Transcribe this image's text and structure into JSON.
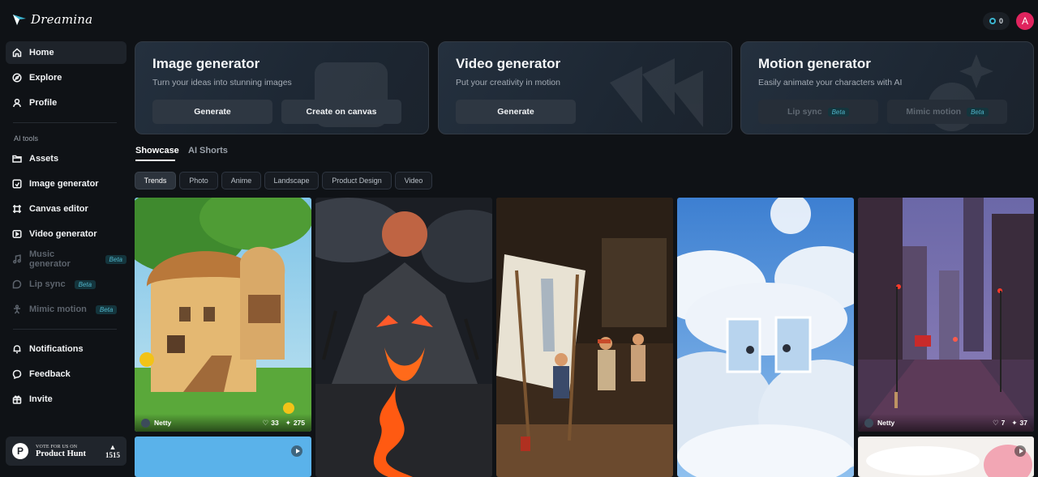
{
  "app": {
    "name": "Dreamina"
  },
  "nav": {
    "main": [
      {
        "label": "Home",
        "icon": "home-icon"
      },
      {
        "label": "Explore",
        "icon": "compass-icon"
      },
      {
        "label": "Profile",
        "icon": "user-icon"
      }
    ],
    "ai_tools_label": "AI tools",
    "tools": [
      {
        "label": "Assets",
        "icon": "folder-icon"
      },
      {
        "label": "Image generator",
        "icon": "image-gen-icon"
      },
      {
        "label": "Canvas editor",
        "icon": "canvas-icon"
      },
      {
        "label": "Video generator",
        "icon": "video-icon"
      },
      {
        "label": "Music generator",
        "icon": "music-icon",
        "badge": "Beta"
      },
      {
        "label": "Lip sync",
        "icon": "lipsync-icon",
        "badge": "Beta"
      },
      {
        "label": "Mimic motion",
        "icon": "mimic-icon",
        "badge": "Beta"
      }
    ],
    "bottom": [
      {
        "label": "Notifications",
        "icon": "bell-icon"
      },
      {
        "label": "Feedback",
        "icon": "feedback-icon"
      },
      {
        "label": "Invite",
        "icon": "gift-icon"
      }
    ]
  },
  "product_hunt": {
    "small": "VOTE FOR US ON",
    "big": "Product Hunt",
    "votes": "1515",
    "logo_letter": "P"
  },
  "header": {
    "credits": "0",
    "avatar_letter": "A"
  },
  "generators": [
    {
      "title": "Image generator",
      "subtitle": "Turn your ideas into stunning images",
      "buttons": [
        {
          "label": "Generate"
        },
        {
          "label": "Create on canvas"
        }
      ]
    },
    {
      "title": "Video generator",
      "subtitle": "Put your creativity in motion",
      "buttons": [
        {
          "label": "Generate"
        }
      ]
    },
    {
      "title": "Motion generator",
      "subtitle": "Easily animate your characters with AI",
      "buttons": [
        {
          "label": "Lip sync",
          "badge": "Beta"
        },
        {
          "label": "Mimic motion",
          "badge": "Beta"
        }
      ]
    }
  ],
  "tabs": [
    {
      "label": "Showcase"
    },
    {
      "label": "AI Shorts"
    }
  ],
  "filters": [
    "Trends",
    "Photo",
    "Anime",
    "Landscape",
    "Product Design",
    "Video"
  ],
  "gallery": [
    {
      "author": "Netty",
      "likes": "33",
      "remixes": "275"
    },
    {
      "author": "Netty",
      "likes": "7",
      "remixes": "37"
    }
  ],
  "colors": {
    "background": "#0f1216",
    "accent": "#3bb4cf",
    "avatar": "#e0245e"
  }
}
